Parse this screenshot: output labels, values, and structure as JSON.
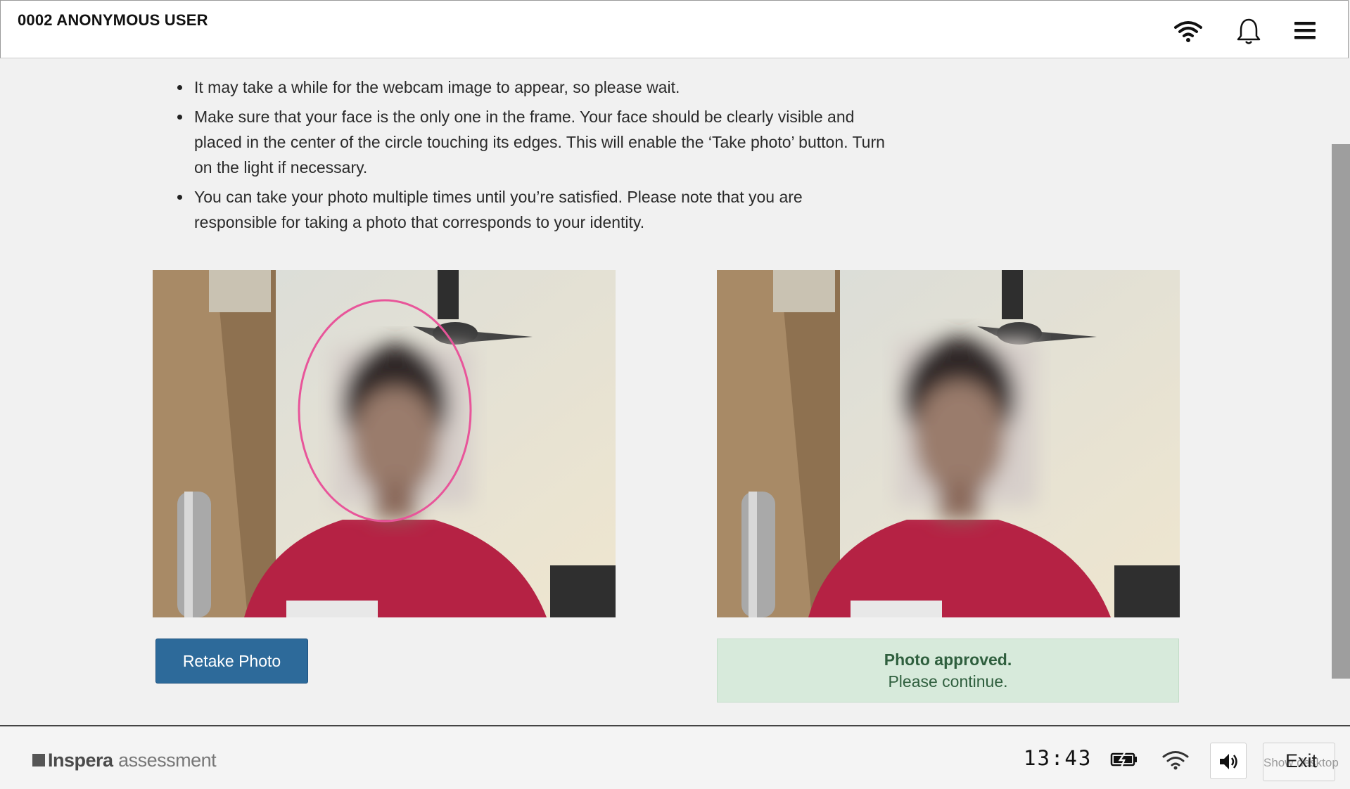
{
  "header": {
    "user_name": "0002 ANONYMOUS USER",
    "icons": [
      "wifi-icon",
      "bell-icon",
      "menu-icon"
    ]
  },
  "instructions": [
    "It may take a while for the webcam image to appear, so please wait.",
    "Make sure that your face is the only one in the frame. Your face should be clearly visible and placed in the center of the circle touching its edges. This will enable the ‘Take photo’ button. Turn on the light if necessary.",
    "You can take your photo multiple times until you’re satisfied. Please note that you are responsible for taking a photo that corresponds to your identity."
  ],
  "photos": {
    "live_feed_circle_color": "#e8559a",
    "retake_label": "Retake Photo"
  },
  "status": {
    "title": "Photo approved.",
    "message": "Please continue."
  },
  "footer": {
    "brand_name": "Inspera",
    "brand_suffix": "assessment",
    "clock": "13:43",
    "exit_label": "Exit",
    "show_desktop_label": "Show desktop"
  },
  "colors": {
    "primary_button": "#2d6a9a",
    "success_background": "#d7eadb",
    "success_text": "#2f5f3e"
  }
}
